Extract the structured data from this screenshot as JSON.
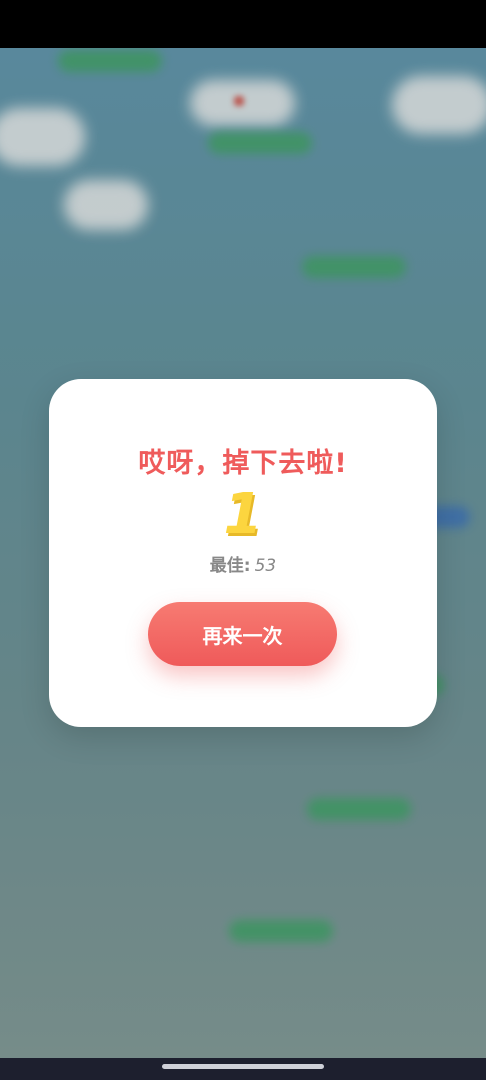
{
  "dialog": {
    "title": "哎呀，掉下去啦!",
    "score": "1",
    "best_label": "最佳:",
    "best_value": "53",
    "restart_label": "再来一次"
  },
  "colors": {
    "title": "#ef5b5b",
    "score": "#fcd53f",
    "button": "#ef5a5a",
    "platform": "#3d9b62",
    "platform_blue": "#3a6fb0"
  }
}
